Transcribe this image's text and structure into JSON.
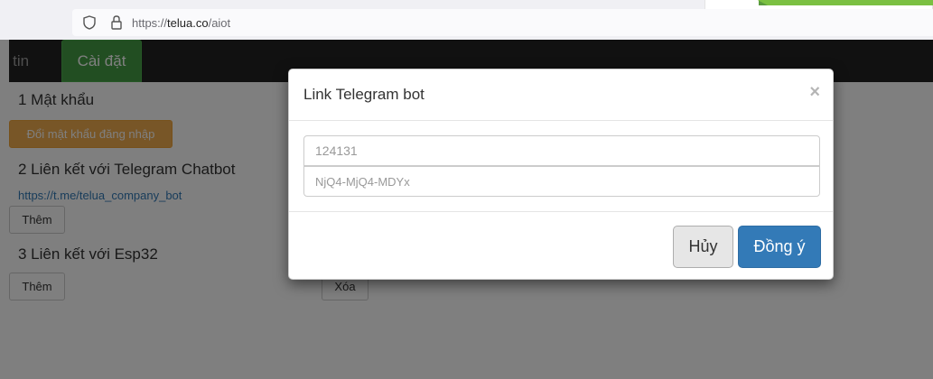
{
  "browser": {
    "url_prefix": "https://",
    "url_domain": "telua.co",
    "url_path": "/aiot"
  },
  "navbar": {
    "info_tab": "g tin",
    "settings_tab": "Cài đặt"
  },
  "sections": {
    "password_title": "1 Mật khẩu",
    "change_password_button": "Đổi mật khẩu đăng nhập",
    "telegram_title": "2 Liên kết với Telegram Chatbot",
    "telegram_link": "https://t.me/telua_company_bot",
    "telegram_add_button": "Thêm",
    "esp32_title": "3 Liên kết với Esp32",
    "esp32_add_button": "Thêm",
    "esp32_delete_button": "Xóa"
  },
  "modal": {
    "title": "Link Telegram bot",
    "close_label": "×",
    "field1_placeholder": "124131",
    "field2_placeholder": "NjQ4-MjQ4-MDYx",
    "cancel_label": "Hủy",
    "ok_label": "Đồng ý"
  },
  "colors": {
    "navbar": "#222222",
    "settings_tab": "#449d44",
    "warning": "#f0ad4e",
    "primary": "#337ab7",
    "link": "#337ab7"
  }
}
